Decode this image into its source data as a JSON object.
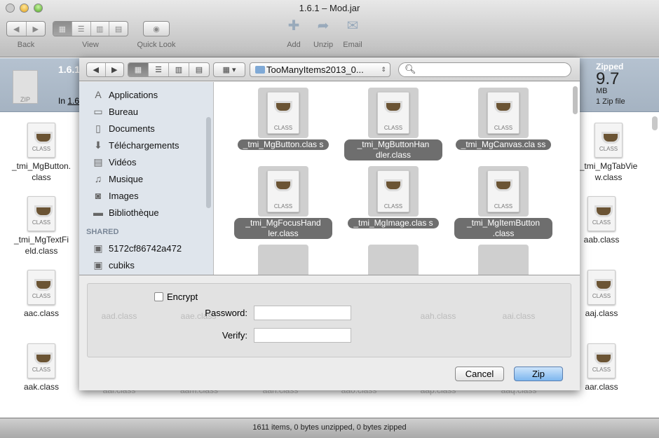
{
  "window": {
    "title": "1.6.1 – Mod.jar"
  },
  "toolbar": {
    "back": "Back",
    "view": "View",
    "quick_look": "Quick Look",
    "add": "Add",
    "unzip": "Unzip",
    "email": "Email"
  },
  "info": {
    "name": "1.6.1",
    "location_prefix": "In",
    "location_link": "1.6.",
    "zipped_label": "Zipped",
    "zipped_size": "9.7",
    "zipped_unit": "MB",
    "zip_count": "1 Zip file"
  },
  "background_files": {
    "left": [
      "_tmi_MgButton.class",
      "_tmi_MgTextField.class",
      "aac.class",
      "aak.class"
    ],
    "right": [
      "_tmi_MgTabView.class",
      "aab.class",
      "aaj.class",
      "aar.class"
    ],
    "faded_mid": [
      "aad.class",
      "aae.class",
      "aah.class",
      "aai.class"
    ],
    "faded_bottom": [
      "aal.class",
      "aam.class",
      "aan.class",
      "aao.class",
      "aap.class",
      "aaq.class"
    ]
  },
  "status": "1611 items, 0 bytes unzipped, 0 bytes zipped",
  "dialog": {
    "path": "TooManyItems2013_0...",
    "search_value": "",
    "sidebar": [
      {
        "label": "Applications",
        "icon": "applications-icon"
      },
      {
        "label": "Bureau",
        "icon": "desktop-icon"
      },
      {
        "label": "Documents",
        "icon": "documents-icon"
      },
      {
        "label": "Téléchargements",
        "icon": "downloads-icon"
      },
      {
        "label": "Vidéos",
        "icon": "movies-icon"
      },
      {
        "label": "Musique",
        "icon": "music-icon"
      },
      {
        "label": "Images",
        "icon": "camera-icon"
      },
      {
        "label": "Bibliothèque",
        "icon": "folder-icon"
      }
    ],
    "shared_header": "SHARED",
    "shared": [
      "5172cf86742a472",
      "cubiks"
    ],
    "files": [
      "_tmi_MgButton.clas s",
      "_tmi_MgButtonHan dler.class",
      "_tmi_MgCanvas.cla ss",
      "_tmi_MgFocusHand ler.class",
      "_tmi_MgImage.clas s",
      "_tmi_MgItemButton .class"
    ],
    "encrypt_label": "Encrypt",
    "encrypt_checked": false,
    "password_label": "Password:",
    "verify_label": "Verify:",
    "password_value": "",
    "verify_value": "",
    "cancel": "Cancel",
    "zip": "Zip"
  }
}
